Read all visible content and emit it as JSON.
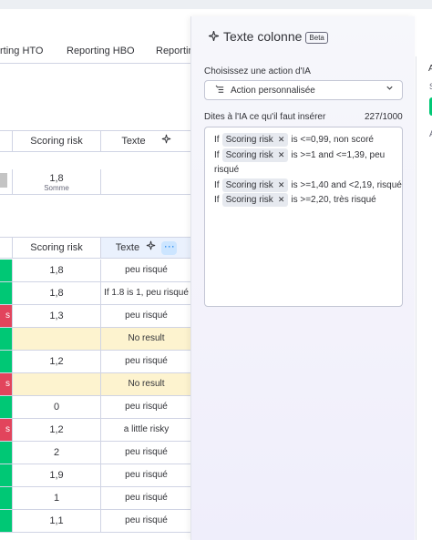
{
  "tabs": [
    "rting HTO",
    "Reporting HBO",
    "Reportin"
  ],
  "table1": {
    "col_score": "Scoring risk",
    "col_text": "Texte",
    "sum_value": "1,8",
    "sum_label": "Somme"
  },
  "table2": {
    "col_score": "Scoring risk",
    "col_text": "Texte"
  },
  "colors": {
    "green": "#00c875",
    "red": "#e2445c",
    "highlight": "#fdf3cf",
    "accent": "#0073ea"
  },
  "rows": [
    {
      "status": "green",
      "status_text": "",
      "score": "1,8",
      "text": "peu risqué",
      "highlight": false
    },
    {
      "status": "green",
      "status_text": "",
      "score": "1,8",
      "text": "If 1.8 is 1, peu risqué",
      "highlight": false
    },
    {
      "status": "red",
      "status_text": "s",
      "score": "1,3",
      "text": "peu risqué",
      "highlight": false
    },
    {
      "status": "green",
      "status_text": "",
      "score": "",
      "text": "No result",
      "highlight": true
    },
    {
      "status": "green",
      "status_text": "",
      "score": "1,2",
      "text": "peu risqué",
      "highlight": false
    },
    {
      "status": "red",
      "status_text": "s",
      "score": "",
      "text": "No result",
      "highlight": true
    },
    {
      "status": "green",
      "status_text": "",
      "score": "0",
      "text": "peu risqué",
      "highlight": false
    },
    {
      "status": "red",
      "status_text": "s",
      "score": "1,2",
      "text": "a little risky",
      "highlight": false
    },
    {
      "status": "green",
      "status_text": "",
      "score": "2",
      "text": "peu risqué",
      "highlight": false
    },
    {
      "status": "green",
      "status_text": "",
      "score": "1,9",
      "text": "peu risqué",
      "highlight": false
    },
    {
      "status": "green",
      "status_text": "",
      "score": "1",
      "text": "peu risqué",
      "highlight": false
    },
    {
      "status": "green",
      "status_text": "",
      "score": "1,1",
      "text": "peu risqué",
      "highlight": false
    }
  ],
  "panel": {
    "title": "Texte colonne",
    "beta": "Beta",
    "action_label": "Choisissez une action d'IA",
    "action_value": "Action personnalisée",
    "prompt_label": "Dites à l'IA ce qu'il faut insérer",
    "counter": "227/1000",
    "rules": [
      {
        "if": "If",
        "chip": "Scoring risk",
        "rest": "is <=0,99, non scoré"
      },
      {
        "if": "If",
        "chip": "Scoring risk",
        "rest": "is >=1 and <=1,39, peu risqué"
      },
      {
        "if": "If",
        "chip": "Scoring risk",
        "rest": "is >=1,40 and <2,19, risqué"
      },
      {
        "if": "If",
        "chip": "Scoring risk",
        "rest": "is >=2,20, très risqué"
      }
    ]
  },
  "right_strip": {
    "letter_a": "A",
    "letter_s": "S",
    "letter_a2": "A"
  }
}
